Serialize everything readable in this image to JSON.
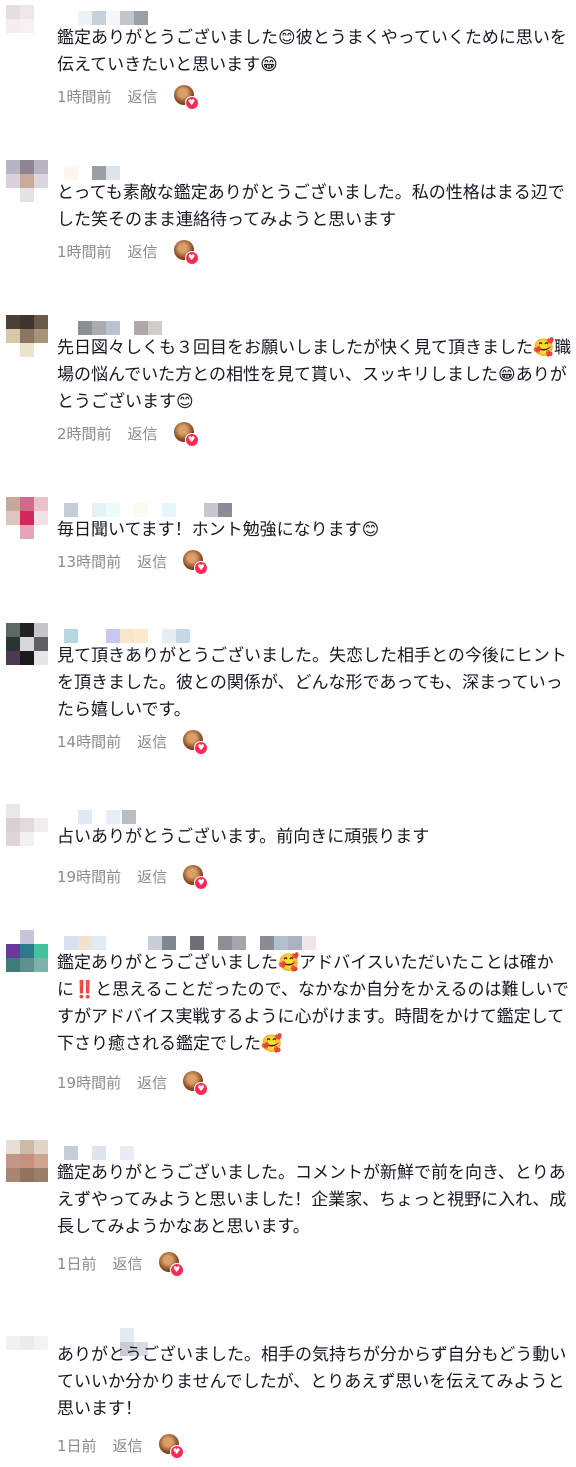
{
  "reply_label": "返信",
  "colors": {
    "meta": "#8a8b91",
    "text": "#161823",
    "like_heart": "#fe2c55"
  },
  "icons": {
    "liked_by_creator": "creator-liked-heart-icon"
  },
  "comments": [
    {
      "text": "鑑定ありがとうございました😊彼とうまくやっていくために思いを伝えていきたいと思います😁",
      "time": "1時間前"
    },
    {
      "text": "とっても素敵な鑑定ありがとうございました。私の性格はまる辺でした笑そのまま連絡待ってみようと思います",
      "time": "1時間前"
    },
    {
      "text": "先日図々しくも３回目をお願いしましたが快く見て頂きました🥰職場の悩んでいた方との相性を見て貰い、スッキリしました😁ありがとうございます😊",
      "time": "2時間前"
    },
    {
      "text": "毎日聞いてます！ホント勉強になります😊",
      "time": "13時間前"
    },
    {
      "text": "見て頂きありがとうございました。失恋した相手との今後にヒントを頂きました。彼との関係が、どんな形であっても、深まっていったら嬉しいです。",
      "time": "14時間前"
    },
    {
      "text": "占いありがとうございます。前向きに頑張ります",
      "time": "19時間前"
    },
    {
      "text": "鑑定ありがとうございました🥰アドバイスいただいたことは確かに‼️と思えることだったので、なかなか自分をかえるのは難しいですがアドバイス実戦するように心がけます。時間をかけて鑑定して下さり癒される鑑定でした🥰",
      "time": "19時間前"
    },
    {
      "text": "鑑定ありがとうございました。コメントが新鮮で前を向き、とりあえずやってみようと思いました！企業家、ちょっと視野に入れ、成長してみようかなあと思います。",
      "time": "1日前"
    },
    {
      "text": "ありがとうございました。相手の気持ちが分からず自分もどう動いていいか分かりませんでしたが、とりあえず思いを伝えてみようと思います！",
      "time": "1日前"
    }
  ]
}
